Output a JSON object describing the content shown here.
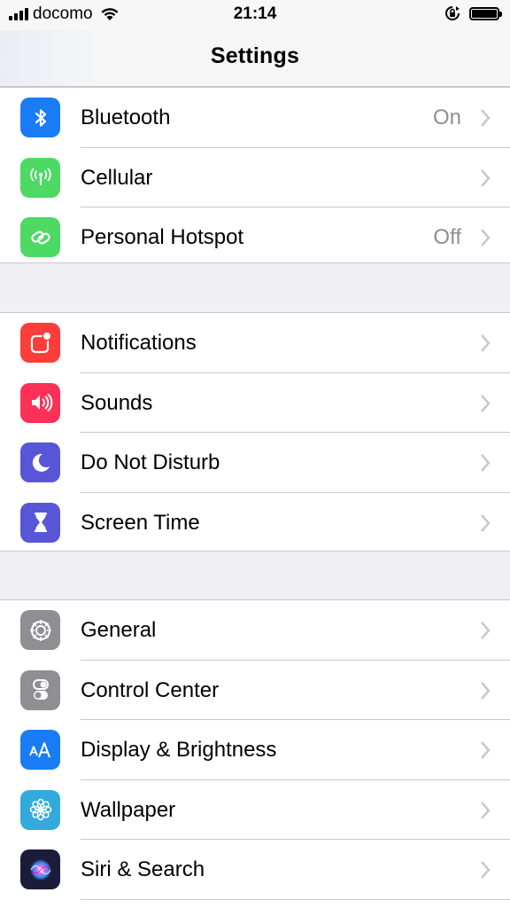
{
  "status_bar": {
    "carrier": "docomo",
    "time": "21:14",
    "icons": [
      "signal-bars-icon",
      "wifi-icon",
      "rotation-lock-icon",
      "battery-icon"
    ]
  },
  "nav": {
    "title": "Settings"
  },
  "groups": [
    {
      "rows": [
        {
          "label": "Bluetooth",
          "value": "On",
          "icon": "bluetooth-icon",
          "color": "#1a7cf5"
        },
        {
          "label": "Cellular",
          "value": "",
          "icon": "antenna-icon",
          "color": "#4cd964"
        },
        {
          "label": "Personal Hotspot",
          "value": "Off",
          "icon": "link-chain-icon",
          "color": "#4cd964"
        }
      ]
    },
    {
      "rows": [
        {
          "label": "Notifications",
          "value": "",
          "icon": "notification-badge-icon",
          "color": "#fc3d39"
        },
        {
          "label": "Sounds",
          "value": "",
          "icon": "speaker-icon",
          "color": "#fc3158"
        },
        {
          "label": "Do Not Disturb",
          "value": "",
          "icon": "moon-icon",
          "color": "#5856d6"
        },
        {
          "label": "Screen Time",
          "value": "",
          "icon": "hourglass-icon",
          "color": "#5856d6"
        }
      ]
    },
    {
      "rows": [
        {
          "label": "General",
          "value": "",
          "icon": "gear-icon",
          "color": "#8e8e93"
        },
        {
          "label": "Control Center",
          "value": "",
          "icon": "toggles-icon",
          "color": "#8e8e93"
        },
        {
          "label": "Display & Brightness",
          "value": "",
          "icon": "text-size-icon",
          "color": "#1a7cf5"
        },
        {
          "label": "Wallpaper",
          "value": "",
          "icon": "flower-icon",
          "color": "#34aadc"
        },
        {
          "label": "Siri & Search",
          "value": "",
          "icon": "siri-icon",
          "color": "#1b1b3a"
        }
      ]
    }
  ]
}
